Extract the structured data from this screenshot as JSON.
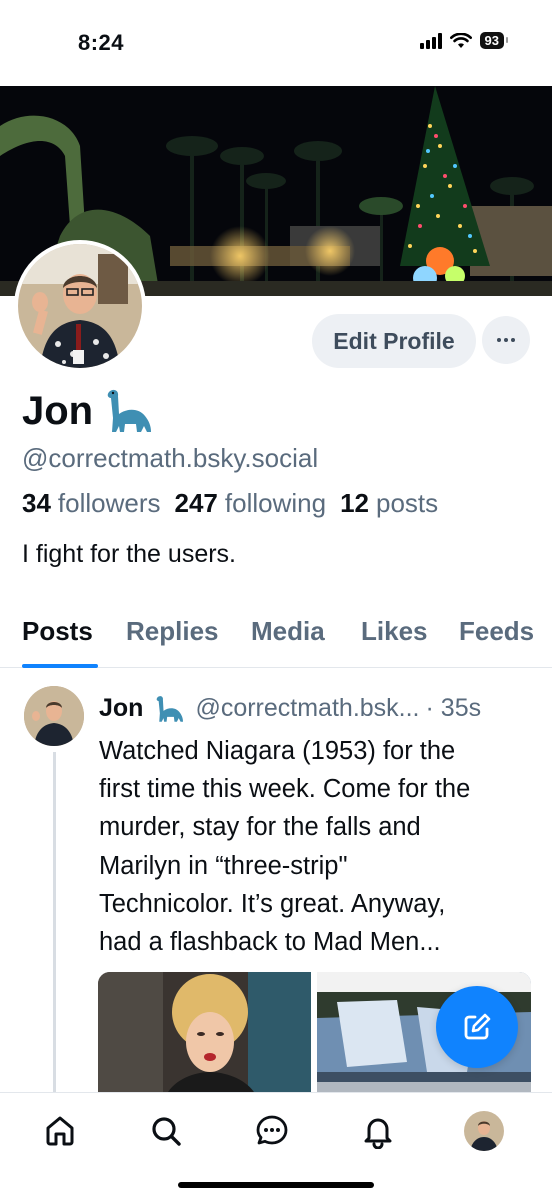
{
  "status_bar": {
    "time": "8:24",
    "battery": "93"
  },
  "profile": {
    "display_name": "Jon",
    "handle": "@correctmath.bsky.social",
    "followers_count": "34",
    "followers_label": "followers",
    "following_count": "247",
    "following_label": "following",
    "posts_count": "12",
    "posts_label": "posts",
    "bio": "I fight for the users."
  },
  "actions": {
    "edit_profile": "Edit Profile"
  },
  "tabs": [
    {
      "label": "Posts",
      "active": true
    },
    {
      "label": "Replies",
      "active": false
    },
    {
      "label": "Media",
      "active": false
    },
    {
      "label": "Likes",
      "active": false
    },
    {
      "label": "Feeds",
      "active": false
    }
  ],
  "post": {
    "author": "Jon",
    "handle": "@correctmath.bsk...",
    "time": "· 35s",
    "text": "Watched Niagara (1953) for the\nfirst time this week. Come for the\nmurder, stay for the falls and\nMarilyn in “three-strip\"\nTechnicolor. It’s great.  Anyway,\nhad a flashback to Mad Men..."
  },
  "nav": [
    {
      "icon": "home-icon"
    },
    {
      "icon": "search-icon"
    },
    {
      "icon": "chat-icon"
    },
    {
      "icon": "bell-icon"
    },
    {
      "icon": "profile-avatar-icon"
    }
  ],
  "colors": {
    "accent": "#1083fe",
    "muted_text": "#5a6b7d",
    "button_bg": "#edf0f4"
  }
}
